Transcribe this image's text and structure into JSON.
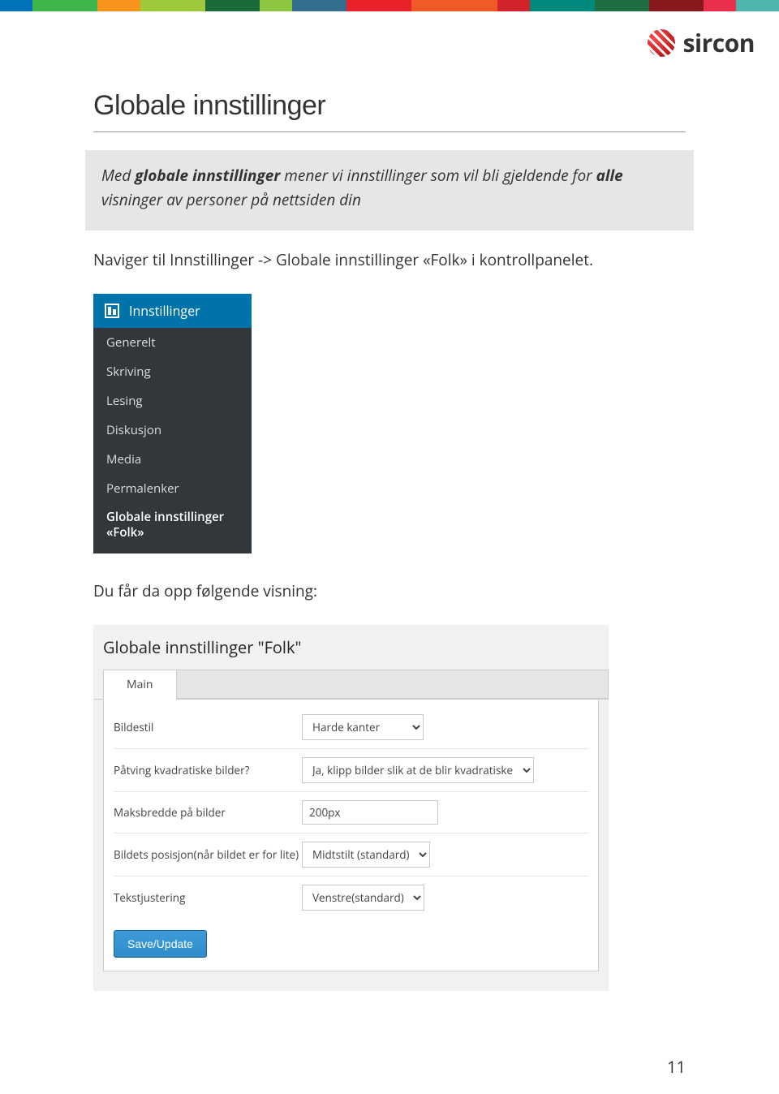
{
  "brand": {
    "name": "sircon"
  },
  "title": "Globale innstillinger",
  "callout": {
    "pre": "Med ",
    "bold1": "globale innstillinger",
    "mid": " mener vi innstillinger som vil bli gjeldende for ",
    "bold2": "alle",
    "post": " visninger av personer på nettsiden din"
  },
  "para1": "Naviger til Innstillinger -> Globale innstillinger «Folk» i kontrollpanelet.",
  "sidebar": {
    "header": "Innstillinger",
    "items": [
      "Generelt",
      "Skriving",
      "Lesing",
      "Diskusjon",
      "Media",
      "Permalenker",
      "Globale innstillinger «Folk»"
    ]
  },
  "para2": "Du får da opp følgende visning:",
  "settings": {
    "heading": "Globale innstillinger \"Folk\"",
    "tab": "Main",
    "rows": {
      "bildestil": {
        "label": "Bildestil",
        "value": "Harde kanter"
      },
      "kvadratisk": {
        "label": "Påtving kvadratiske bilder?",
        "value": "Ja, klipp bilder slik at de blir kvadratiske"
      },
      "maksbredde": {
        "label": "Maksbredde på bilder",
        "value": "200px"
      },
      "posisjon": {
        "label": "Bildets posisjon(når bildet er for lite)",
        "value": "Midtstilt (standard)"
      },
      "tekstjust": {
        "label": "Tekstjustering",
        "value": "Venstre(standard)"
      }
    },
    "save": "Save/Update"
  },
  "page_num": "11",
  "band_colors": [
    {
      "c": "#0072bc",
      "w": 3
    },
    {
      "c": "#3db54a",
      "w": 6
    },
    {
      "c": "#f7941d",
      "w": 4
    },
    {
      "c": "#9dc93b",
      "w": 6
    },
    {
      "c": "#196c3a",
      "w": 5
    },
    {
      "c": "#8cc63f",
      "w": 3
    },
    {
      "c": "#336e8f",
      "w": 5
    },
    {
      "c": "#e8212b",
      "w": 6
    },
    {
      "c": "#ef5a28",
      "w": 8
    },
    {
      "c": "#d2232a",
      "w": 3
    },
    {
      "c": "#00897b",
      "w": 6
    },
    {
      "c": "#1f6e43",
      "w": 5
    },
    {
      "c": "#89181c",
      "w": 5
    },
    {
      "c": "#ec2f4b",
      "w": 3
    },
    {
      "c": "#4cb6ac",
      "w": 4
    }
  ]
}
